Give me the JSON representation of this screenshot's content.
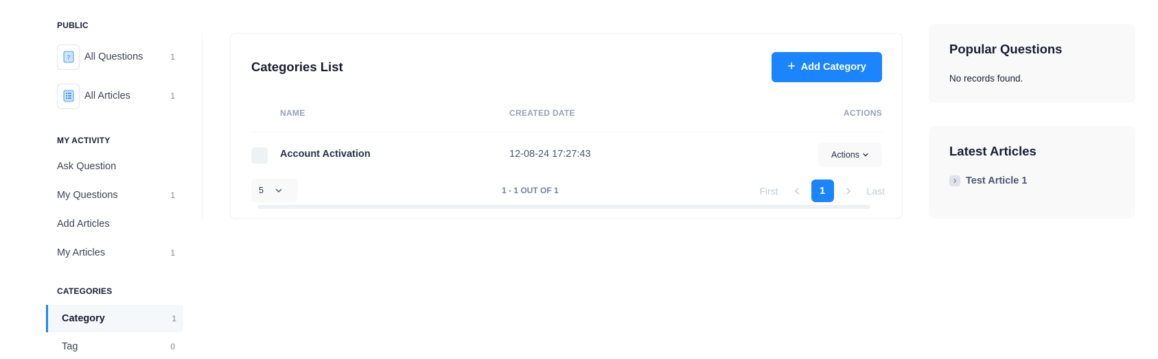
{
  "sidebar": {
    "sections": {
      "public": "PUBLIC",
      "my_activity": "MY ACTIVITY",
      "categories": "CATEGORIES"
    },
    "items": [
      {
        "label": "All Questions",
        "count": "1",
        "icon": "question-doc-icon"
      },
      {
        "label": "All Articles",
        "count": "1",
        "icon": "list-doc-icon"
      },
      {
        "label": "Ask Question",
        "count": ""
      },
      {
        "label": "My Questions",
        "count": "1"
      },
      {
        "label": "Add Articles",
        "count": ""
      },
      {
        "label": "My Articles",
        "count": "1"
      },
      {
        "label": "Category",
        "count": "1",
        "active": true
      },
      {
        "label": "Tag",
        "count": "0"
      }
    ]
  },
  "main": {
    "title": "Categories List",
    "add_button": "Add Category",
    "table": {
      "headers": [
        "NAME",
        "CREATED DATE",
        "ACTIONS"
      ],
      "rows": [
        {
          "name": "Account Activation",
          "created": "12-08-24 17:27:43",
          "actions": "Actions"
        }
      ]
    },
    "pagination": {
      "page_size": "5",
      "info": "1 - 1 OUT OF 1",
      "first": "First",
      "last": "Last",
      "current": "1"
    }
  },
  "popular": {
    "title": "Popular Questions",
    "empty": "No records found."
  },
  "latest": {
    "title": "Latest Articles",
    "items": [
      "Test Article 1"
    ]
  },
  "colors": {
    "accent": "#1b84ff",
    "muted": "#99a1b7"
  }
}
